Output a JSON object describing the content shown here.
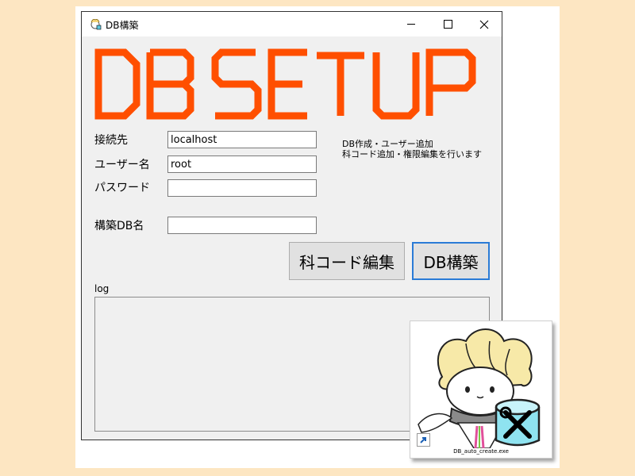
{
  "window": {
    "title": "DB構築"
  },
  "banner": {
    "text": "DB SETUP",
    "color": "#ff4f00"
  },
  "form": {
    "host_label": "接続先",
    "host_value": "localhost",
    "user_label": "ユーザー名",
    "user_value": "root",
    "password_label": "パスワード",
    "password_value": "",
    "dbname_label": "構築DB名",
    "dbname_value": ""
  },
  "info": {
    "line1": "DB作成・ユーザー追加",
    "line2": "科コード追加・権限編集を行います"
  },
  "buttons": {
    "edit_label": "科コード編集",
    "build_label": "DB構築"
  },
  "log": {
    "label": "log",
    "value": ""
  },
  "shortcut": {
    "filename": "DB_auto_create.exe",
    "icon": "mascot-database-tools-icon"
  }
}
